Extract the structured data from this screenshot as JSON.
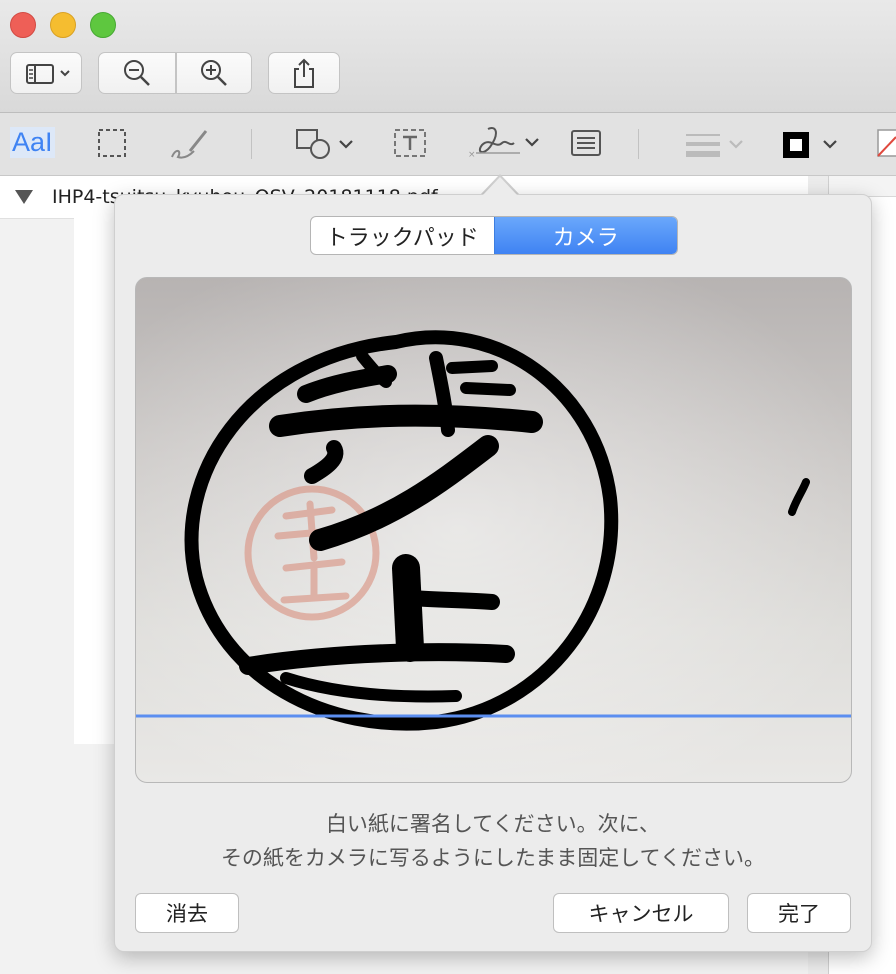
{
  "app": {
    "window_title": "IHP4-t..."
  },
  "document": {
    "filename": "IHP4-tsuitsu_kyuhou_OSV_20181118.pdf"
  },
  "markup": {
    "text_style_label": "AaI"
  },
  "signature_popover": {
    "tabs": [
      "トラックパッド",
      "カメラ"
    ],
    "active_tab": "カメラ",
    "instruction_line1": "白い紙に署名してください。次に、",
    "instruction_line2": "その紙をカメラに写るようにしたまま固定してください。",
    "clear_label": "消去",
    "cancel_label": "キャンセル",
    "done_label": "完了"
  },
  "colors": {
    "accent": "#3f83f3",
    "guide_line": "#5b8ef0",
    "stamp_red": "#d9907f"
  },
  "icons": {
    "sidebar": "sidebar-icon",
    "zoom_out": "zoom-out-icon",
    "zoom_in": "zoom-in-icon",
    "share": "share-icon",
    "selection": "rect-select-icon",
    "sketch": "sketch-icon",
    "shapes": "shapes-icon",
    "text_box": "text-box-icon",
    "sign": "signature-icon",
    "note": "note-icon",
    "line_style": "line-style-icon",
    "border_color": "border-color-icon"
  }
}
